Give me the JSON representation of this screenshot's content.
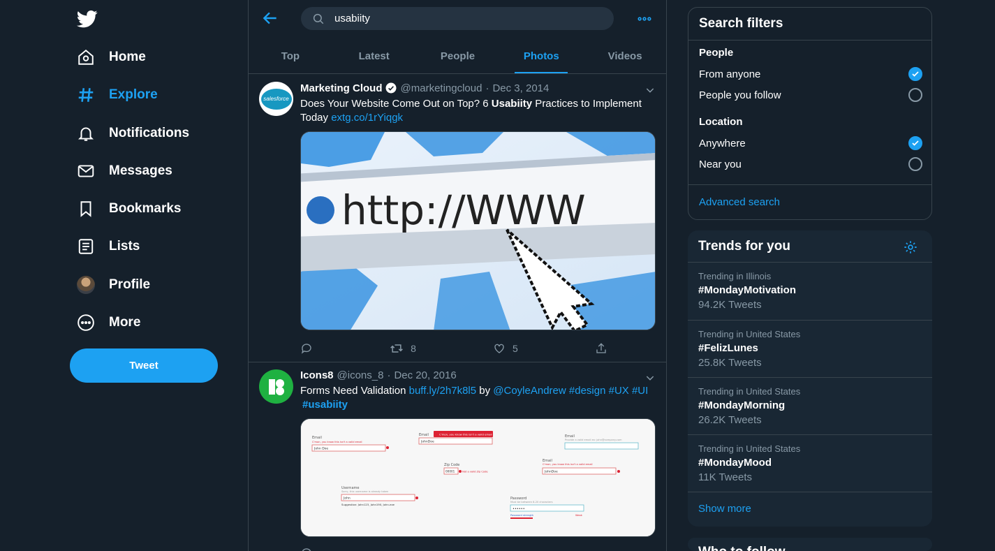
{
  "nav": {
    "items": [
      {
        "label": "Home",
        "icon": "home-icon"
      },
      {
        "label": "Explore",
        "icon": "hashtag-icon",
        "active": true
      },
      {
        "label": "Notifications",
        "icon": "bell-icon"
      },
      {
        "label": "Messages",
        "icon": "envelope-icon"
      },
      {
        "label": "Bookmarks",
        "icon": "bookmark-icon"
      },
      {
        "label": "Lists",
        "icon": "list-icon"
      },
      {
        "label": "Profile",
        "icon": "avatar"
      },
      {
        "label": "More",
        "icon": "more-circle-icon"
      }
    ],
    "tweet_button": "Tweet"
  },
  "search": {
    "value": "usabiity"
  },
  "tabs": [
    {
      "label": "Top"
    },
    {
      "label": "Latest"
    },
    {
      "label": "People"
    },
    {
      "label": "Photos",
      "active": true
    },
    {
      "label": "Videos"
    }
  ],
  "tweets": [
    {
      "name": "Marketing Cloud",
      "handle": "@marketingcloud",
      "sep": "·",
      "date": "Dec 3, 2014",
      "text_pre": "Does Your Website Come Out on Top? 6 ",
      "text_bold": "Usabiity",
      "text_post": " Practices to Implement Today ",
      "link": "extg.co/1rYiqgk",
      "avatar_text": "salesforce",
      "image_text": "http://WWW",
      "retweets": "8",
      "likes": "5"
    },
    {
      "name": "Icons8",
      "handle": "@icons_8",
      "sep": "·",
      "date": "Dec 20, 2016",
      "text_pre": "Forms Need Validation ",
      "link1": "buff.ly/2h7k8l5",
      "by": " by ",
      "mention": "@CoyleAndrew",
      "tags": " #design #UX #UI",
      "tag2": "#usabiity",
      "form": {
        "email_label": "Email",
        "email_err": "C'mon, you know this isn't a valid email",
        "john": "John Doe",
        "johndoe": "JohnDoe",
        "zip_label": "Zip Code",
        "zip_value": "00001",
        "zip_err": "Not a valid Zip Code",
        "user_label": "Username",
        "user_err": "Sorry, this username is already taken",
        "user_value": "John",
        "suggest": "Suggestion: John123, John190, John-exe",
        "email_hint": "Provide a valid email ex: john@company.com",
        "pass_label": "Password",
        "pass_hint": "Must be between 8-20 characters",
        "pass_value": "••••••",
        "pass_strength": "Weak",
        "pass_link": "Password strength"
      }
    }
  ],
  "filters": {
    "title": "Search filters",
    "people_title": "People",
    "from_anyone": "From anyone",
    "people_follow": "People you follow",
    "location_title": "Location",
    "anywhere": "Anywhere",
    "near_you": "Near you",
    "advanced": "Advanced search"
  },
  "trends": {
    "title": "Trends for you",
    "items": [
      {
        "context": "Trending in Illinois",
        "name": "#MondayMotivation",
        "count": "94.2K Tweets"
      },
      {
        "context": "Trending in United States",
        "name": "#FelizLunes",
        "count": "25.8K Tweets"
      },
      {
        "context": "Trending in United States",
        "name": "#MondayMorning",
        "count": "26.2K Tweets"
      },
      {
        "context": "Trending in United States",
        "name": "#MondayMood",
        "count": "11K Tweets"
      }
    ],
    "show_more": "Show more"
  },
  "who_to_follow": {
    "title": "Who to follow"
  },
  "colors": {
    "accent": "#1da1f2",
    "bg": "#15202b",
    "panel": "#192734",
    "border": "#38444d",
    "muted": "#8899a6"
  }
}
